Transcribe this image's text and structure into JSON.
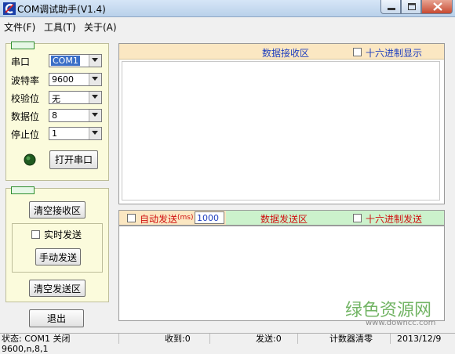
{
  "window": {
    "title": "COM调试助手(V1.4)"
  },
  "menu": [
    "文件(F)",
    "工具(T)",
    "关于(A)"
  ],
  "serial": {
    "port_label": "串口",
    "port_value": "COM1",
    "baud_label": "波特率",
    "baud_value": "9600",
    "parity_label": "校验位",
    "parity_value": "无",
    "databits_label": "数据位",
    "databits_value": "8",
    "stopbits_label": "停止位",
    "stopbits_value": "1",
    "open_button": "打开串口"
  },
  "actions": {
    "clear_receive": "清空接收区",
    "realtime_send": "实时发送",
    "manual_send": "手动发送",
    "clear_send": "清空发送区",
    "exit": "退出"
  },
  "receive": {
    "title": "数据接收区",
    "hex_display": "十六进制显示"
  },
  "send": {
    "auto_send": "自动发送",
    "ms_unit": "(ms)",
    "interval": "1000",
    "title": "数据发送区",
    "hex_send": "十六进制发送"
  },
  "status": {
    "state": "状态: COM1 关闭 9600,n,8,1",
    "received": "收到:0",
    "sent": "发送:0",
    "reset": "计数器清零",
    "date": "2013/12/9"
  },
  "watermark": {
    "text": "绿色资源网",
    "url": "www.downcc.com"
  },
  "colors": {
    "accent_blue": "#1f3fbf",
    "accent_red": "#d01010",
    "panel_bg": "#fbfbdc",
    "header_orange": "#fbe7c2",
    "header_green": "#ccf2cc"
  }
}
